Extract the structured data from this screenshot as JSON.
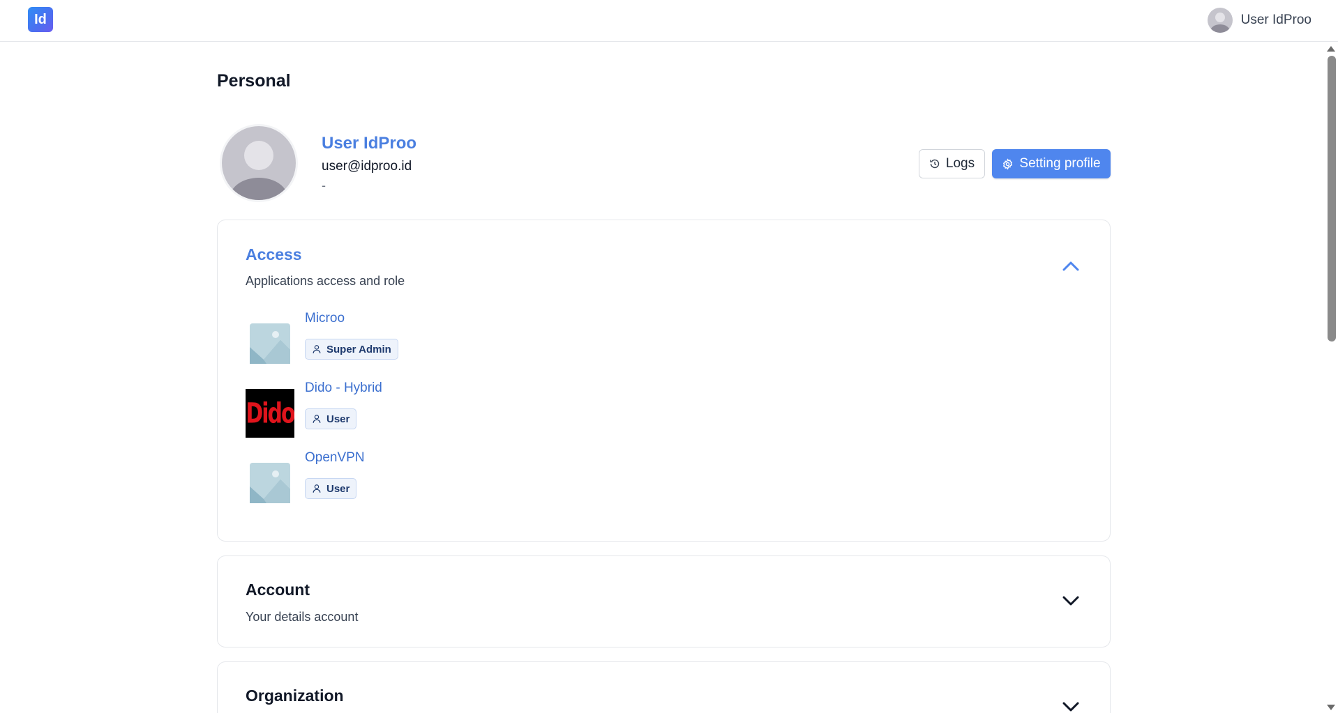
{
  "header": {
    "logo_text": "Id",
    "user_name": "User IdProo"
  },
  "page": {
    "title": "Personal"
  },
  "profile": {
    "name": "User IdProo",
    "email": "user@idproo.id",
    "extra": "-",
    "logs_label": "Logs",
    "setting_label": "Setting profile"
  },
  "access": {
    "title": "Access",
    "subtitle": "Applications access and role",
    "apps": [
      {
        "name": "Microo",
        "role": "Super Admin",
        "thumb": "placeholder-image-icon"
      },
      {
        "name": "Dido - Hybrid",
        "role": "User",
        "thumb": "dido-logo",
        "logo_text": "Dido"
      },
      {
        "name": "OpenVPN",
        "role": "User",
        "thumb": "placeholder-image-icon"
      }
    ]
  },
  "account": {
    "title": "Account",
    "subtitle": "Your details account"
  },
  "organization": {
    "title": "Organization"
  },
  "colors": {
    "accent": "#4f86ee",
    "link": "#3b6fcf",
    "badge_bg": "#eef3fb"
  }
}
